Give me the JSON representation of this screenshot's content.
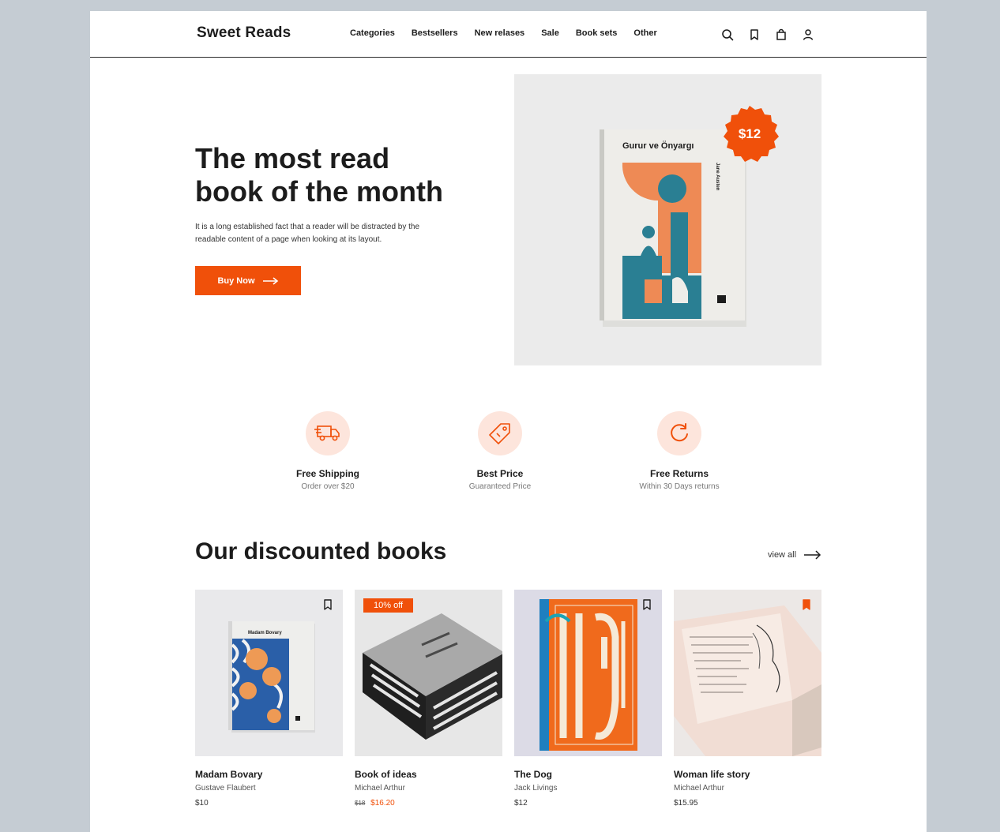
{
  "header": {
    "logo": "Sweet Reads",
    "nav": [
      "Categories",
      "Bestsellers",
      "New relases",
      "Sale",
      "Book sets",
      "Other"
    ]
  },
  "hero": {
    "title_line1": "The most read",
    "title_line2": "book of the month",
    "description": "It is a long established fact that a reader will be distracted by the readable content of a page when looking at its layout.",
    "button_label": "Buy Now",
    "price_badge": "$12",
    "book_title": "Gurur ve Önyargı",
    "book_author": "Jane Austen"
  },
  "features": [
    {
      "title": "Free Shipping",
      "subtitle": "Order over $20"
    },
    {
      "title": "Best Price",
      "subtitle": "Guaranteed Price"
    },
    {
      "title": "Free Returns",
      "subtitle": "Within 30 Days returns"
    }
  ],
  "discounted": {
    "title": "Our discounted books",
    "view_all": "view all",
    "books": [
      {
        "title": "Madam Bovary",
        "author": "Gustave Flaubert",
        "price": "$10",
        "cover_text": "Madam Bovary"
      },
      {
        "title": "Book of ideas",
        "author": "Michael Arthur",
        "old_price": "$18",
        "price": "$16.20",
        "badge": "10% off"
      },
      {
        "title": "The Dog",
        "author": "Jack Livings",
        "price": "$12"
      },
      {
        "title": "Woman life story",
        "author": "Michael Arthur",
        "price": "$15.95"
      }
    ]
  },
  "colors": {
    "accent": "#f0500a",
    "feature_bg": "#fde5dc",
    "teal": "#2a7f93",
    "orange": "#ee8a55"
  }
}
